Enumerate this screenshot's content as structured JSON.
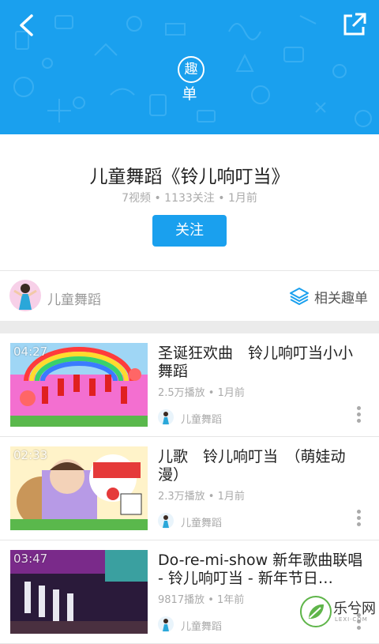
{
  "header": {
    "badge_char": "趣",
    "badge_word": "单",
    "color": "#1aa0ee"
  },
  "collection": {
    "title": "儿童舞蹈《铃儿响叮当》",
    "meta": "7视频 • 1133关注 • 1月前",
    "follow_label": "关注"
  },
  "author": {
    "name": "儿童舞蹈",
    "related_label": "相关趣单"
  },
  "videos": [
    {
      "duration": "04:27",
      "title": "圣诞狂欢曲　铃儿响叮当小小舞蹈",
      "meta": "2.5万播放 • 1月前",
      "author": "儿童舞蹈"
    },
    {
      "duration": "02:33",
      "title": "儿歌　铃儿响叮当　（萌娃动漫）",
      "meta": "2.3万播放 • 1月前",
      "author": "儿童舞蹈"
    },
    {
      "duration": "03:47",
      "title": "Do-re-mi-show 新年歌曲联唱 - 铃儿响叮当 - 新年节日…",
      "meta": "9817播放 • 1年前",
      "author": "儿童舞蹈"
    }
  ],
  "watermark": {
    "text": "乐兮网",
    "sub": "LEXI·COM"
  }
}
